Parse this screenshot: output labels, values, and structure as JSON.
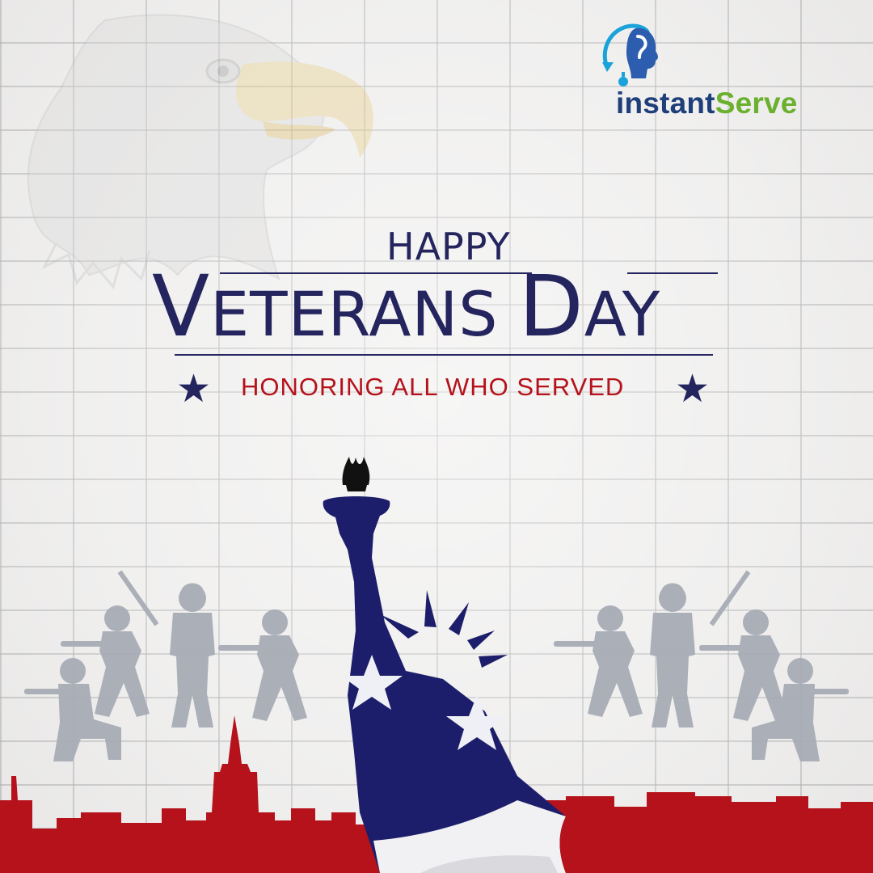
{
  "brand": {
    "name_part1": "instant",
    "name_part2": "Serve",
    "color_primary": "#1f3f7a",
    "color_secondary": "#6bb02e",
    "mark_icon": "head-profile-question-mark-icon"
  },
  "headline": {
    "happy": "HAPPY",
    "title_initial_1": "V",
    "title_rest_1": "ETERANS",
    "title_initial_2": "D",
    "title_rest_2": "AY",
    "subtitle": "HONORING ALL WHO SERVED",
    "title_color": "#24245e",
    "subtitle_color": "#b5121b"
  },
  "decor": {
    "eagle": "bald-eagle-watermark",
    "statue": "statue-of-liberty-flag-silhouette",
    "soldiers": "soldier-silhouettes",
    "skyline": "red-city-skyline",
    "star_icon": "star-icon",
    "skyline_color": "#b5121b",
    "flag_blue": "#1d1e6b"
  }
}
